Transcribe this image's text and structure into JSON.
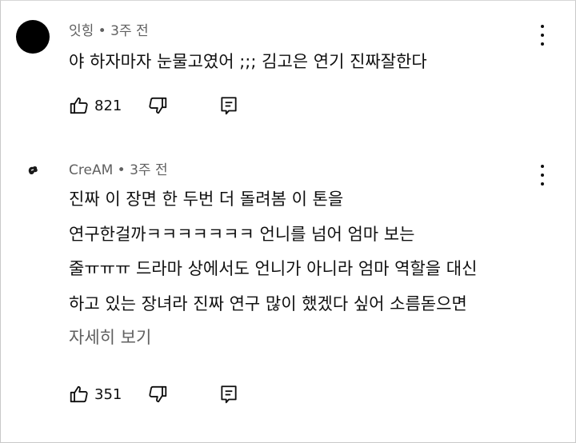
{
  "comments": [
    {
      "author": "잇힝",
      "time": "3주 전",
      "lines": [
        "야 하자마자 눈물고였어 ;;; 김고은 연기 진짜잘한다"
      ],
      "likes": "821"
    },
    {
      "author": "CreAM",
      "time": "3주 전",
      "lines": [
        "진짜 이 장면 한 두번 더 돌려봄 이 톤을",
        "연구한걸까ㅋㅋㅋㅋㅋㅋㅋ 언니를 넘어 엄마 보는",
        "줄ㅠㅠㅠ 드라마 상에서도 언니가 아니라 엄마 역할을 대신",
        "하고 있는 장녀라 진짜 연구 많이 했겠다 싶어 소름돋으면"
      ],
      "read_more": "자세히 보기",
      "likes": "351"
    }
  ],
  "separator": " • ",
  "icons": {
    "like": "thumbs-up-icon",
    "dislike": "thumbs-down-icon",
    "reply": "reply-icon",
    "menu": "more-vertical-icon"
  }
}
